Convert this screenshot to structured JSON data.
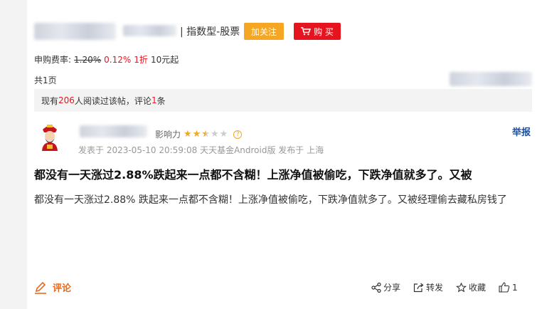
{
  "header": {
    "fund_type": "| 指数型-股票",
    "follow_label": "加关注",
    "buy_label": "购 买"
  },
  "fee": {
    "label": "申购费率:",
    "original": "1.20%",
    "discounted": "0.12%",
    "discount": "1折",
    "minimum": "10元起"
  },
  "pager": {
    "text": "共1页"
  },
  "stats": {
    "prefix": "现有",
    "readers": "206",
    "mid": "人阅读过该帖，评论",
    "comments": "1",
    "suffix": "条"
  },
  "post": {
    "influence_label": "影响力",
    "rating_stars": 2.5,
    "report_label": "举报",
    "meta": "发表于 2023-05-10 20:59:08 天天基金Android版 发布于 上海",
    "title": "都没有一天涨过2.88%跌起来一点都不含糊！上涨净值被偷吃，下跌净值就多了。又被",
    "body": "都没有一天涨过2.88% 跌起来一点都不含糊！上涨净值被偷吃，下跌净值就多了。又被经理偷去藏私房钱了"
  },
  "footer": {
    "comment_label": "评论",
    "share_label": "分享",
    "forward_label": "转发",
    "favorite_label": "收藏",
    "like_count": "1"
  },
  "colors": {
    "accent_orange": "#f5a623",
    "buy_red": "#e6141e",
    "link_blue": "#1a4fa8"
  }
}
